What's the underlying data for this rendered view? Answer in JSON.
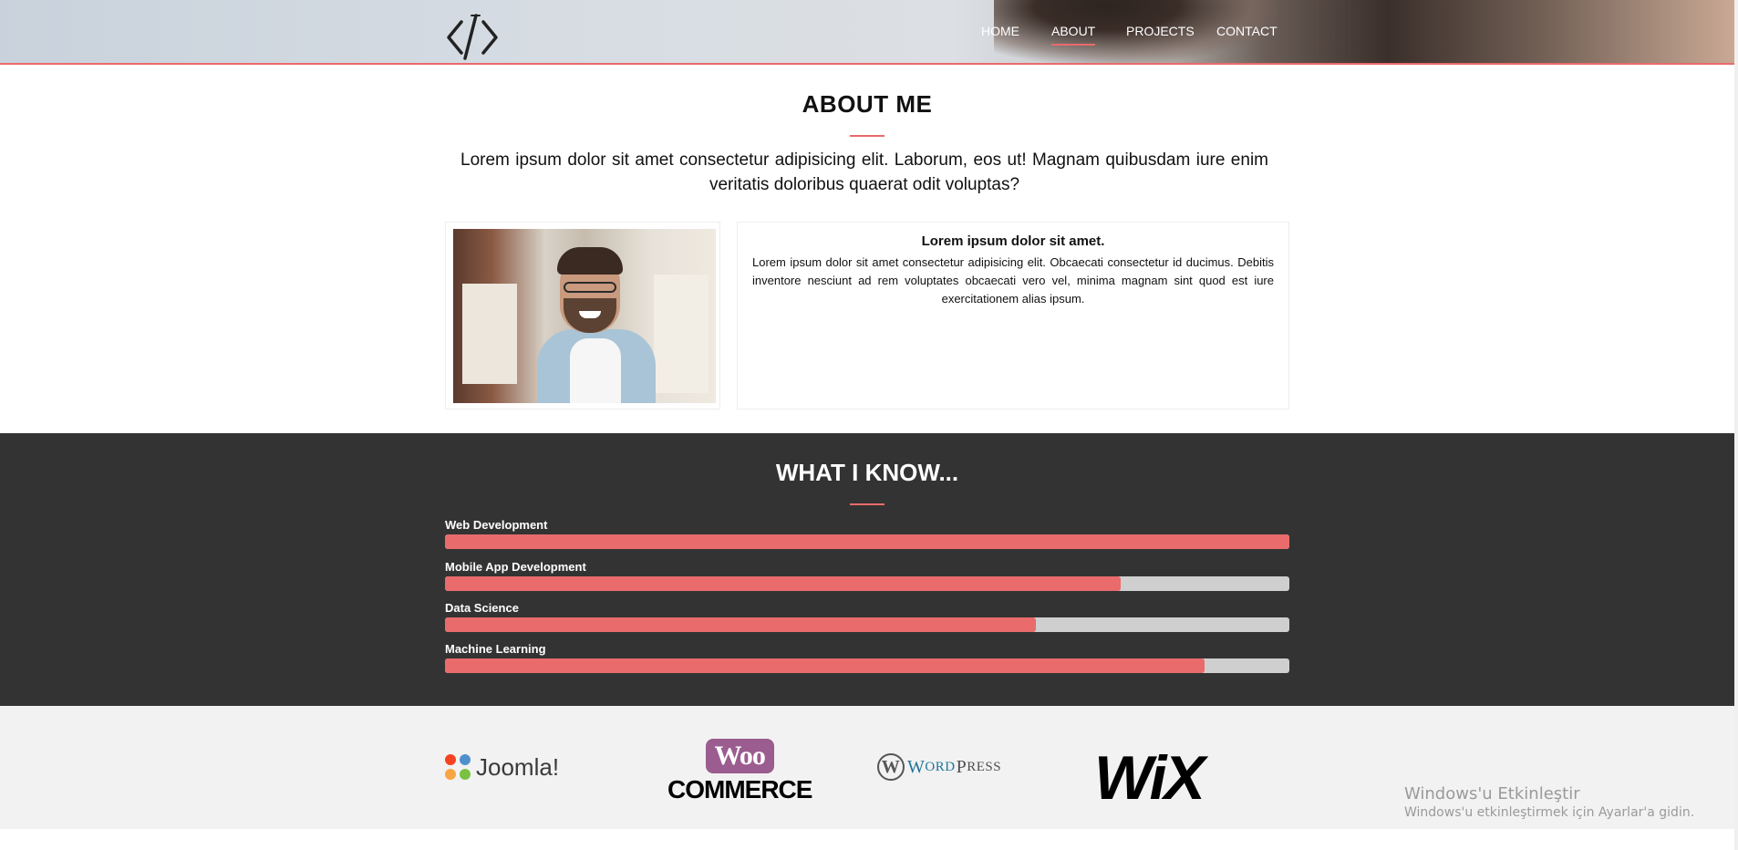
{
  "nav": {
    "items": [
      {
        "label": "HOME",
        "active": false
      },
      {
        "label": "ABOUT",
        "active": true
      },
      {
        "label": "PROJECTS",
        "active": false
      },
      {
        "label": "CONTACT",
        "active": false
      }
    ],
    "logo_icon": "code-brackets-icon"
  },
  "about": {
    "title": "ABOUT ME",
    "intro": "Lorem ipsum dolor sit amet consectetur adipisicing elit. Laborum, eos ut! Magnam quibusdam iure enim veritatis doloribus quaerat odit voluptas?",
    "card_title": "Lorem ipsum dolor sit amet.",
    "card_text": "Lorem ipsum dolor sit amet consectetur adipisicing elit. Obcaecati consectetur id ducimus. Debitis inventore nesciunt ad rem voluptates obcaecati vero vel, minima magnam sint quod est iure exercitationem alias ipsum."
  },
  "skills": {
    "title": "WHAT I KNOW...",
    "items": [
      {
        "label": "Web Development",
        "percent": 100
      },
      {
        "label": "Mobile App Development",
        "percent": 80
      },
      {
        "label": "Data Science",
        "percent": 70
      },
      {
        "label": "Machine Learning",
        "percent": 90
      }
    ]
  },
  "partners": {
    "joomla": "Joomla!",
    "woo_top": "Woo",
    "woo_bottom": "COMMERCE",
    "wordpress_a": "W",
    "wordpress_b": "ORD",
    "wordpress_c": "P",
    "wordpress_d": "RESS",
    "wix": "WiX"
  },
  "windows": {
    "title": "Windows'u Etkinleştir",
    "subtitle": "Windows'u etkinleştirmek için Ayarlar'a gidin."
  },
  "colors": {
    "accent": "#e96b6b",
    "dark_section": "#333333",
    "bar_track": "#cfcfcf"
  }
}
